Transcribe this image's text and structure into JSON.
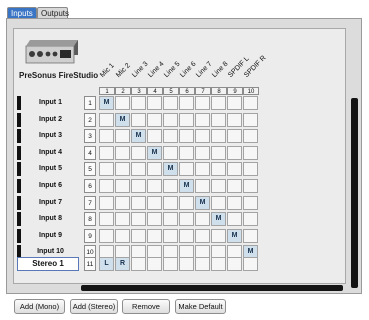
{
  "tabs": [
    {
      "label": "Inputs",
      "active": true
    },
    {
      "label": "Outputs",
      "active": false
    }
  ],
  "device": {
    "name": "PreSonus FireStudio"
  },
  "channels": [
    "Mic 1",
    "Mic 2",
    "Line 3",
    "Line 4",
    "Line 5",
    "Line 6",
    "Line 7",
    "Line 8",
    "SPDIF L",
    "SPDIF R"
  ],
  "column_numbers": [
    "1",
    "2",
    "3",
    "4",
    "5",
    "6",
    "7",
    "8",
    "9",
    "10"
  ],
  "rows": [
    {
      "label": "Input 1",
      "num": "1"
    },
    {
      "label": "Input 2",
      "num": "2"
    },
    {
      "label": "Input 3",
      "num": "3"
    },
    {
      "label": "Input 4",
      "num": "4"
    },
    {
      "label": "Input 5",
      "num": "5"
    },
    {
      "label": "Input 6",
      "num": "6"
    },
    {
      "label": "Input 7",
      "num": "7"
    },
    {
      "label": "Input 8",
      "num": "8"
    },
    {
      "label": "Input 9",
      "num": "9"
    },
    {
      "label": "Input 10",
      "num": "10"
    }
  ],
  "stereo_row": {
    "value": "Stereo 1",
    "num": "11"
  },
  "mono_marker": "M",
  "stereo_markers": {
    "left": "L",
    "right": "R"
  },
  "buttons": {
    "add_mono": "Add (Mono)",
    "add_stereo": "Add (Stereo)",
    "remove": "Remove",
    "make_default": "Make Default"
  },
  "colors": {
    "active_tab": "#3a74c4",
    "cell_on": "#cfe0ec",
    "scrollbar": "#141414"
  }
}
